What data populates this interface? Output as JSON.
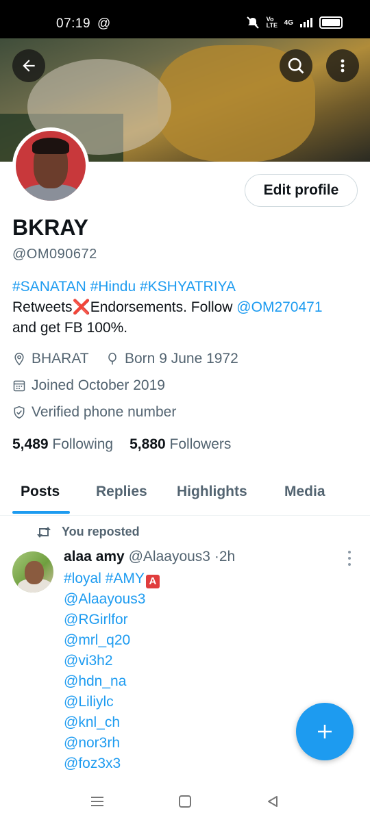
{
  "status_bar": {
    "time": "07:19",
    "at_symbol": "@",
    "network_label": "Vo LTE",
    "network_type": "4G"
  },
  "banner": {
    "back_icon": "arrow-left-icon",
    "search_icon": "search-icon",
    "more_icon": "more-vertical-icon"
  },
  "profile": {
    "edit_profile_label": "Edit profile",
    "name": "BKRAY",
    "handle": "@OM090672",
    "bio_hashtags": "#SANATAN #Hindu #KSHYATRIYA",
    "bio_text_1": "Retweets",
    "bio_emoji": "❌",
    "bio_text_2": "Endorsements. Follow ",
    "bio_mention": "@OM270471",
    "bio_text_3": "and get FB 100%.",
    "location": "BHARAT",
    "birthday": "Born 9 June 1972",
    "joined": "Joined October 2019",
    "verified": "Verified phone number",
    "following_count": "5,489",
    "following_label": "Following",
    "followers_count": "5,880",
    "followers_label": "Followers"
  },
  "tabs": [
    {
      "label": "Posts",
      "active": true
    },
    {
      "label": "Replies",
      "active": false
    },
    {
      "label": "Highlights",
      "active": false
    },
    {
      "label": "Media",
      "active": false
    }
  ],
  "post": {
    "repost_label": "You reposted",
    "author_name": "alaa amy",
    "author_handle": "@Alaayous3",
    "separator": "·",
    "time": "2h",
    "hashtags": "#loyal #AMY",
    "badge": "A",
    "mentions": [
      "@Alaayous3",
      "@RGirlfor",
      "@mrl_q20",
      "@vi3h2",
      "@hdn_na",
      "@Liliylc",
      "@knl_ch",
      "@nor3rh",
      "@foz3x3"
    ]
  },
  "colors": {
    "accent": "#1d9bf0",
    "text_primary": "#0f1419",
    "text_secondary": "#536471"
  }
}
